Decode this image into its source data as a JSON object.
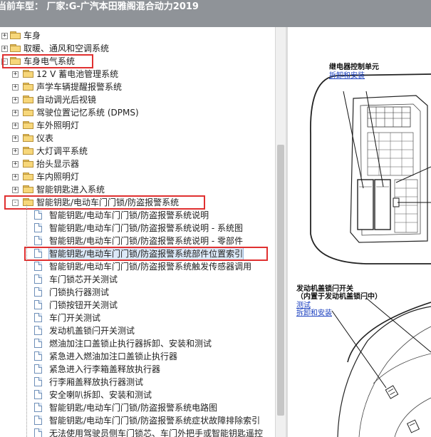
{
  "title_bar": {
    "text": "当前车型：  厂家:G-广汽本田雅阁混合动力2019"
  },
  "tree": {
    "items": [
      {
        "level": 0,
        "kind": "folder",
        "expander": "+",
        "label": "车身"
      },
      {
        "level": 0,
        "kind": "folder",
        "expander": "+",
        "label": "取暖、通风和空调系统"
      },
      {
        "level": 0,
        "kind": "folder",
        "expander": "-",
        "label": "车身电气系统",
        "highlight": true
      },
      {
        "level": 1,
        "kind": "folder",
        "expander": "+",
        "label": "12 V 蓄电池管理系统"
      },
      {
        "level": 1,
        "kind": "folder",
        "expander": "+",
        "label": "声学车辆提醒报警系统"
      },
      {
        "level": 1,
        "kind": "folder",
        "expander": "+",
        "label": "自动调光后视镜"
      },
      {
        "level": 1,
        "kind": "folder",
        "expander": "+",
        "label": "驾驶位置记忆系统 (DPMS)"
      },
      {
        "level": 1,
        "kind": "folder",
        "expander": "+",
        "label": "车外照明灯"
      },
      {
        "level": 1,
        "kind": "folder",
        "expander": "+",
        "label": "仪表"
      },
      {
        "level": 1,
        "kind": "folder",
        "expander": "+",
        "label": "大灯调平系统"
      },
      {
        "level": 1,
        "kind": "folder",
        "expander": "+",
        "label": "抬头显示器"
      },
      {
        "level": 1,
        "kind": "folder",
        "expander": "+",
        "label": "车内照明灯"
      },
      {
        "level": 1,
        "kind": "folder",
        "expander": "+",
        "label": "智能钥匙进入系统"
      },
      {
        "level": 1,
        "kind": "folder",
        "expander": "-",
        "label": "智能钥匙/电动车门门锁/防盗报警系统",
        "highlight": true
      },
      {
        "level": 2,
        "kind": "doc",
        "label": "智能钥匙/电动车门门锁/防盗报警系统说明"
      },
      {
        "level": 2,
        "kind": "doc",
        "label": "智能钥匙/电动车门门锁/防盗报警系统说明 - 系统图"
      },
      {
        "level": 2,
        "kind": "doc",
        "label": "智能钥匙/电动车门门锁/防盗报警系统说明 - 零部件"
      },
      {
        "level": 2,
        "kind": "doc",
        "label": "智能钥匙/电动车门门锁/防盗报警系统部件位置索引",
        "selected": true,
        "highlight": true
      },
      {
        "level": 2,
        "kind": "doc",
        "label": "智能钥匙/电动车门门锁/防盗报警系统触发传感器调用"
      },
      {
        "level": 2,
        "kind": "doc",
        "label": "车门锁芯开关测试"
      },
      {
        "level": 2,
        "kind": "doc",
        "label": "门锁执行器测试"
      },
      {
        "level": 2,
        "kind": "doc",
        "label": "门锁按钮开关测试"
      },
      {
        "level": 2,
        "kind": "doc",
        "label": "车门开关测试"
      },
      {
        "level": 2,
        "kind": "doc",
        "label": "发动机盖锁闩开关测试"
      },
      {
        "level": 2,
        "kind": "doc",
        "label": "燃油加注口盖锁止执行器拆卸、安装和测试"
      },
      {
        "level": 2,
        "kind": "doc",
        "label": "紧急进入燃油加注口盖锁止执行器"
      },
      {
        "level": 2,
        "kind": "doc",
        "label": "紧急进入行李箱盖释放执行器"
      },
      {
        "level": 2,
        "kind": "doc",
        "label": "行李厢盖释放执行器测试"
      },
      {
        "level": 2,
        "kind": "doc",
        "label": "安全喇叭拆卸、安装和测试"
      },
      {
        "level": 2,
        "kind": "doc",
        "label": "智能钥匙/电动车门门锁/防盗报警系统电路图"
      },
      {
        "level": 2,
        "kind": "doc",
        "label": "智能钥匙/电动车门门锁/防盗报警系统症状故障排除索引"
      },
      {
        "level": 2,
        "kind": "doc",
        "label": "无法使用驾驶员侧车门锁芯、车门外把手或智能钥匙遥控"
      }
    ]
  },
  "diagram": {
    "relay_unit_title": "继电器控制单元",
    "relay_unit_link": "拆卸和安装",
    "hood_switch_title": "发动机盖锁闩开关",
    "hood_switch_subtitle": "（内置于发动机盖锁闩中）",
    "hood_switch_link_test": "测试",
    "hood_switch_link_remove": "拆卸和安装"
  }
}
